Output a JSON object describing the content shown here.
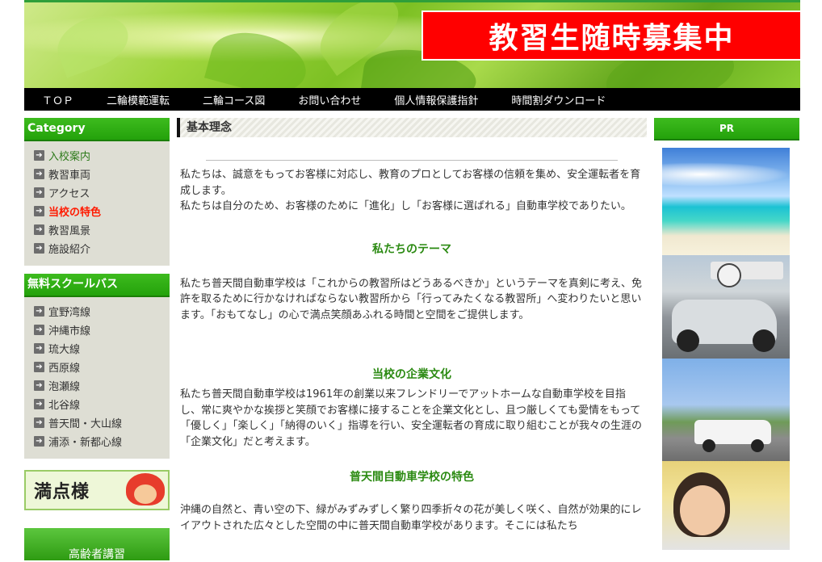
{
  "header": {
    "recruit_banner": "教習生随時募集中"
  },
  "nav": {
    "items": [
      "ＴＯＰ",
      "二輪模範運転",
      "二輪コース図",
      "お問い合わせ",
      "個人情報保護指針",
      "時間割ダウンロード"
    ]
  },
  "sidebar": {
    "category_title": "Category",
    "category_items": [
      "入校案内",
      "教習車両",
      "アクセス",
      "当校の特色",
      "教習風景",
      "施設紹介"
    ],
    "bus_title": "無料スクールバス",
    "bus_items": [
      "宜野湾線",
      "沖縄市線",
      "琉大線",
      "西原線",
      "泡瀬線",
      "北谷線",
      "普天間・大山線",
      "浦添・新都心線"
    ],
    "manten_banner": "満点様",
    "elderly_banner": "高齢者講習"
  },
  "main": {
    "title": "基本理念",
    "intro": [
      "私たちは、誠意をもってお客様に対応し、教育のプロとしてお客様の信頼を集め、安全運転者を育成します。",
      "私たちは自分のため、お客様のために「進化」し「お客様に選ばれる」自動車学校でありたい。"
    ],
    "theme_title": "私たちのテーマ",
    "theme_text": "私たち普天間自動車学校は「これからの教習所はどうあるべきか」というテーマを真剣に考え、免許を取るために行かなければならない教習所から「行ってみたくなる教習所」へ変わりたいと思います。「おもてなし」の心で満点笑顔あふれる時間と空間をご提供します。",
    "culture_title": "当校の企業文化",
    "culture_text": "私たち普天間自動車学校は1961年の創業以来フレンドリーでアットホームな自動車学校を目指し、常に爽やかな挨拶と笑顔でお客様に接することを企業文化とし、且つ厳しくても愛情をもって「優しく」「楽しく」「納得のいく」指導を行い、安全運転者の育成に取り組むことが我々の生涯の「企業文化」だと考えます。",
    "feature_title": "普天間自動車学校の特色",
    "feature_text": "沖縄の自然と、青い空の下、緑がみずみずしく繁り四季折々の花が美しく咲く、自然が効果的にレイアウトされた広々とした空間の中に普天間自動車学校があります。そこには私たち"
  },
  "right": {
    "pr_title": "PR"
  },
  "colors": {
    "accent_green": "#2b8a12",
    "banner_red": "#ff0000",
    "active_red": "#ff1a00",
    "nav_bg": "#000000"
  }
}
